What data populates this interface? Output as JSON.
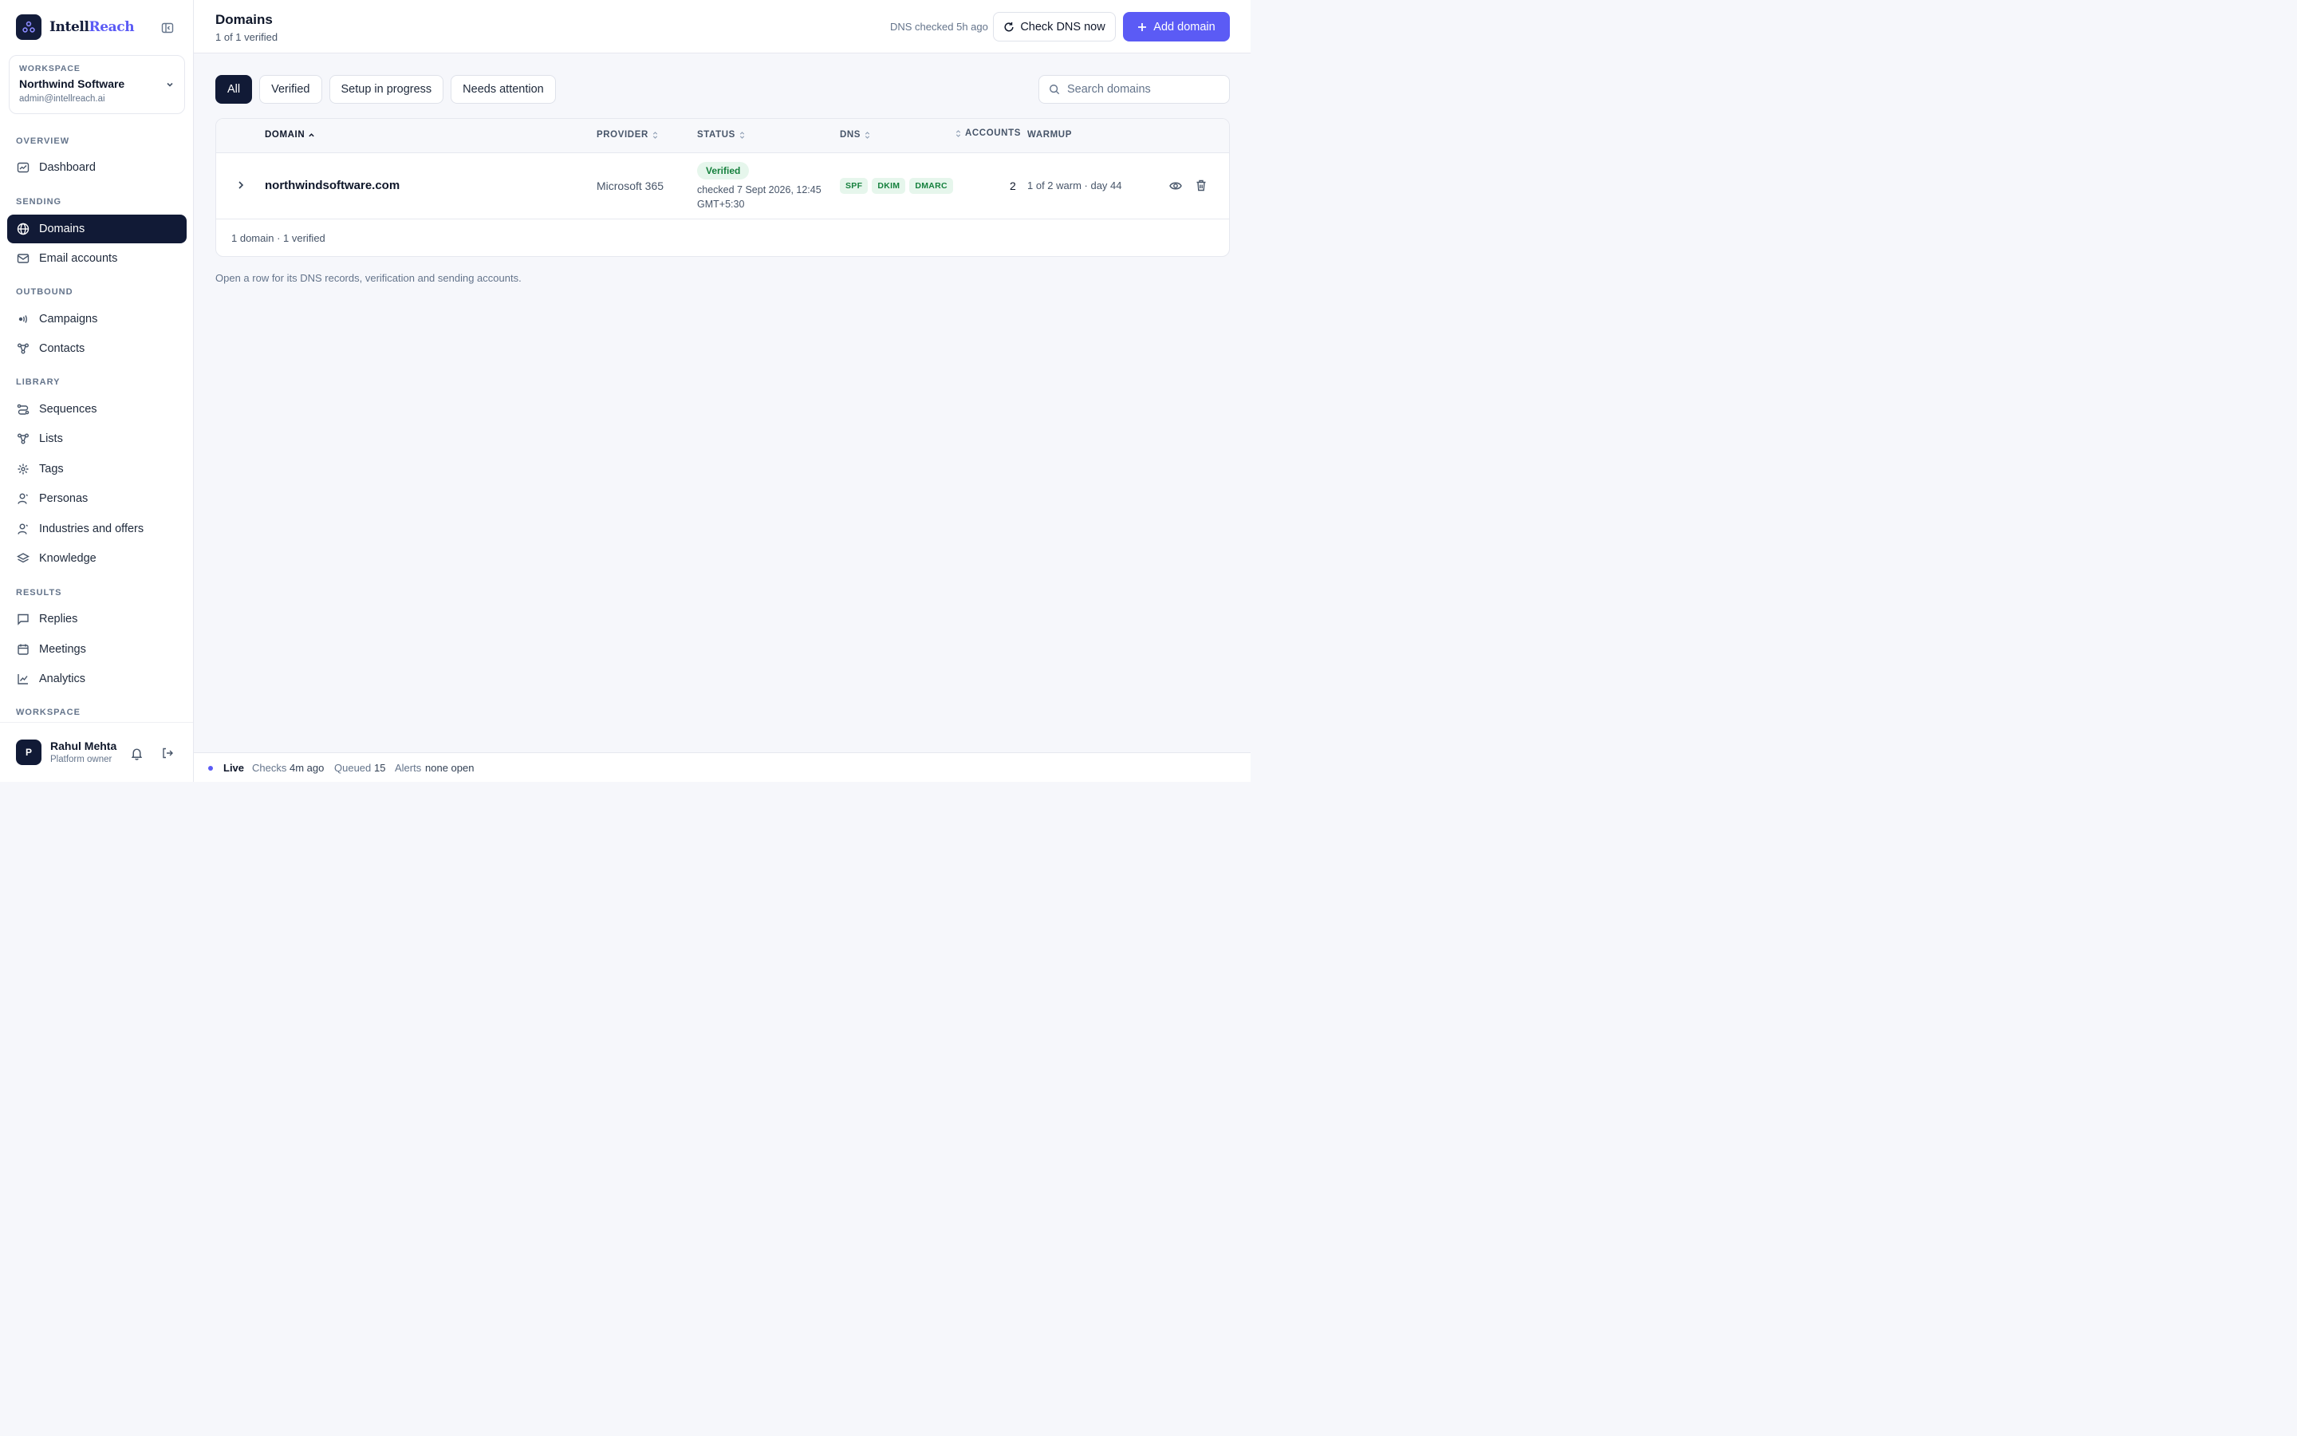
{
  "brand": {
    "name_part1": "Intell",
    "name_part2": "Reach"
  },
  "workspace": {
    "label": "WORKSPACE",
    "name": "Northwind Software",
    "email": "admin@intellreach.ai"
  },
  "nav": {
    "overview": "OVERVIEW",
    "dashboard": "Dashboard",
    "sending": "SENDING",
    "domains": "Domains",
    "email_accounts": "Email accounts",
    "outbound": "OUTBOUND",
    "campaigns": "Campaigns",
    "contacts": "Contacts",
    "library": "LIBRARY",
    "sequences": "Sequences",
    "lists": "Lists",
    "tags": "Tags",
    "personas": "Personas",
    "industries": "Industries and offers",
    "knowledge": "Knowledge",
    "results": "RESULTS",
    "replies": "Replies",
    "meetings": "Meetings",
    "analytics": "Analytics",
    "workspace_section": "WORKSPACE"
  },
  "user": {
    "initial": "P",
    "name": "Rahul Mehta",
    "role": "Platform owner"
  },
  "header": {
    "title": "Domains",
    "subtitle": "1 of 1 verified",
    "dns_checked": "DNS checked 5h ago",
    "check_dns_label": "Check DNS now",
    "add_domain_label": "Add domain"
  },
  "filters": [
    "All",
    "Verified",
    "Setup in progress",
    "Needs attention"
  ],
  "search": {
    "placeholder": "Search domains"
  },
  "table": {
    "columns": {
      "domain": "DOMAIN",
      "provider": "PROVIDER",
      "status": "STATUS",
      "dns": "DNS",
      "accounts": "ACCOUNTS",
      "warmup": "WARMUP"
    },
    "rows": [
      {
        "domain": "northwindsoftware.com",
        "provider": "Microsoft 365",
        "status": "Verified",
        "checked": "checked 7 Sept 2026, 12:45 GMT+5:30",
        "dns": [
          "SPF",
          "DKIM",
          "DMARC"
        ],
        "accounts": "2",
        "warmup": "1 of 2 warm · day 44"
      }
    ],
    "footer": "1 domain · 1 verified"
  },
  "hint": "Open a row for its DNS records, verification and sending accounts.",
  "statusbar": {
    "live": "Live",
    "checks_label": "Checks",
    "checks_value": "4m ago",
    "queued_label": "Queued",
    "queued_value": "15",
    "alerts_label": "Alerts",
    "alerts_value": "none open"
  },
  "colors": {
    "accent": "#5b5bf5",
    "nav_active": "#111a36",
    "success": "#15803d",
    "success_bg": "#e6f6ec"
  }
}
